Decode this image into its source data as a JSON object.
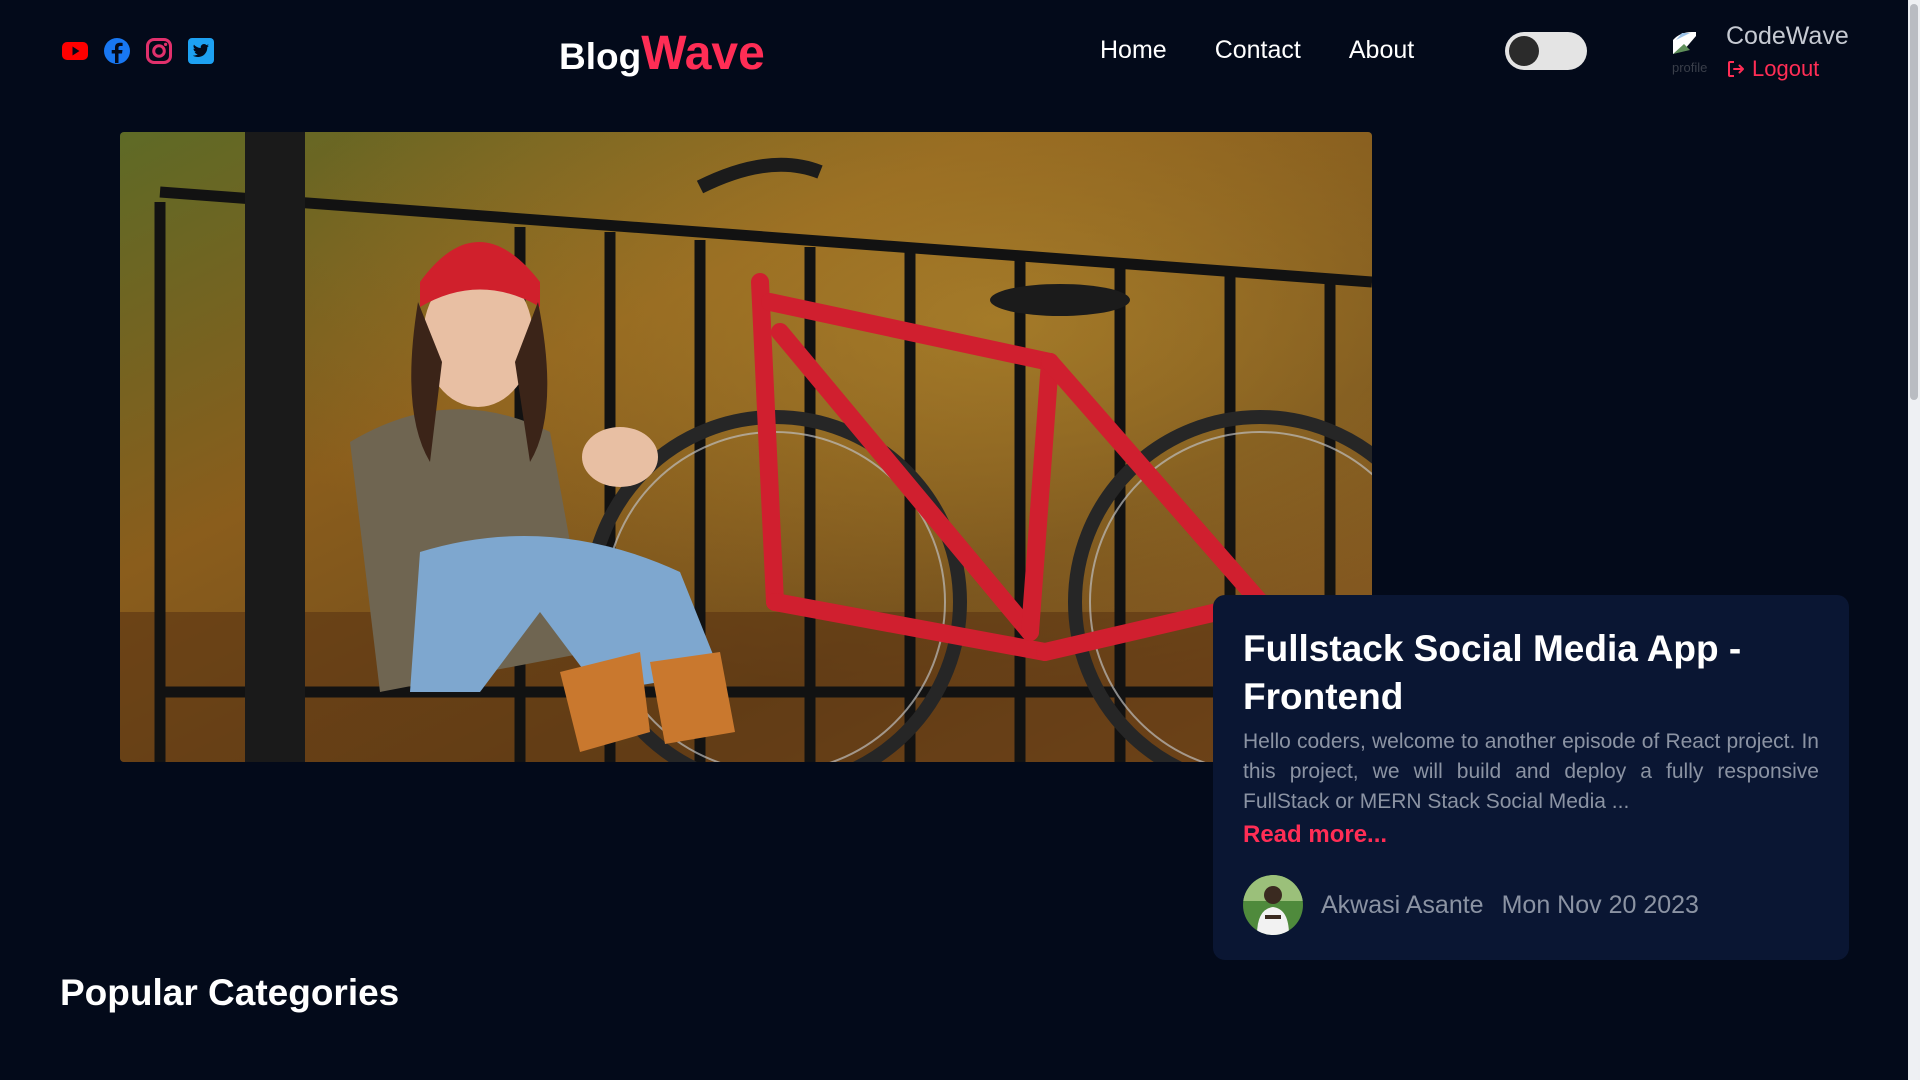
{
  "header": {
    "socials": [
      {
        "icon": "youtube-icon",
        "color": "#ff0000"
      },
      {
        "icon": "facebook-icon",
        "color": "#1877f2"
      },
      {
        "icon": "instagram-icon",
        "color": "#e1306c"
      },
      {
        "icon": "twitter-icon",
        "color": "#1da1f2"
      }
    ],
    "logo": {
      "part1": "Blog",
      "part2": "Wave",
      "accent_color": "#ff2d55"
    },
    "nav": {
      "home": "Home",
      "contact": "Contact",
      "about": "About"
    },
    "theme_toggle": {
      "state": "off"
    },
    "user": {
      "profile_alt": "profile",
      "name": "CodeWave",
      "logout_label": "Logout"
    }
  },
  "featured_post": {
    "title": "Fullstack Social Media App - Frontend",
    "excerpt": "Hello coders, welcome to another episode of React project. In this project, we will build and deploy a fully responsive FullStack or MERN Stack Social Media ...",
    "read_more": "Read more...",
    "author": "Akwasi Asante",
    "date": "Mon Nov 20 2023"
  },
  "sections": {
    "popular_categories": "Popular Categories"
  },
  "colors": {
    "background": "#030a1a",
    "card": "#0a1633",
    "accent": "#ff2d55",
    "muted_text": "#8b93a3"
  }
}
